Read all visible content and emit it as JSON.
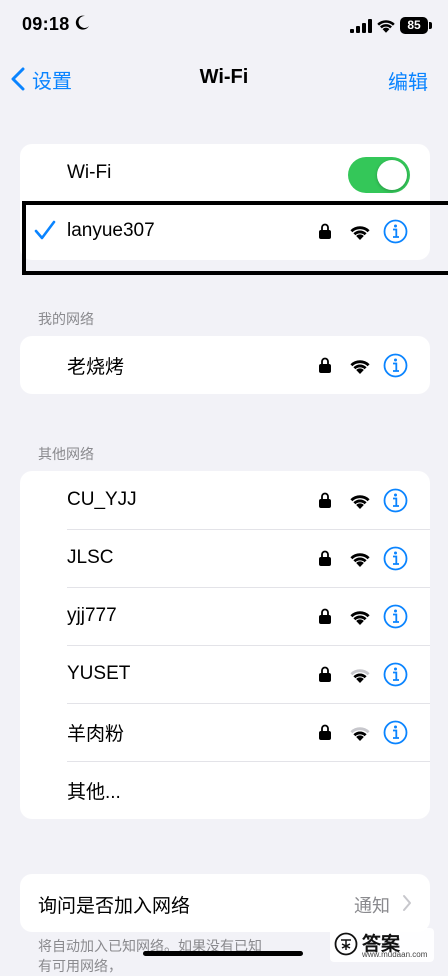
{
  "status_bar": {
    "time": "09:18",
    "battery": "85"
  },
  "nav": {
    "back_label": "设置",
    "title": "Wi-Fi",
    "edit_label": "编辑"
  },
  "wifi_toggle": {
    "label": "Wi-Fi",
    "on": true
  },
  "connected": {
    "name": "lanyue307"
  },
  "my_networks": {
    "header": "我的网络",
    "items": [
      {
        "name": "老烧烤"
      }
    ]
  },
  "other_networks": {
    "header": "其他网络",
    "items": [
      {
        "name": "CU_YJJ",
        "signal": "full"
      },
      {
        "name": "JLSC",
        "signal": "full"
      },
      {
        "name": "yjj777",
        "signal": "full"
      },
      {
        "name": "YUSET",
        "signal": "weak"
      },
      {
        "name": "羊肉粉",
        "signal": "weak"
      }
    ],
    "other_label": "其他..."
  },
  "ask_join": {
    "label": "询问是否加入网络",
    "value": "通知"
  },
  "footer": {
    "line1": "将自动加入已知网络。如果没有已知",
    "line2": "有可用网络，"
  },
  "watermark": {
    "text": "答案",
    "url": "www.mudaan.com"
  },
  "colors": {
    "accent": "#0a84ff",
    "toggle_on": "#34c759",
    "secondary": "#8a8a8e"
  }
}
